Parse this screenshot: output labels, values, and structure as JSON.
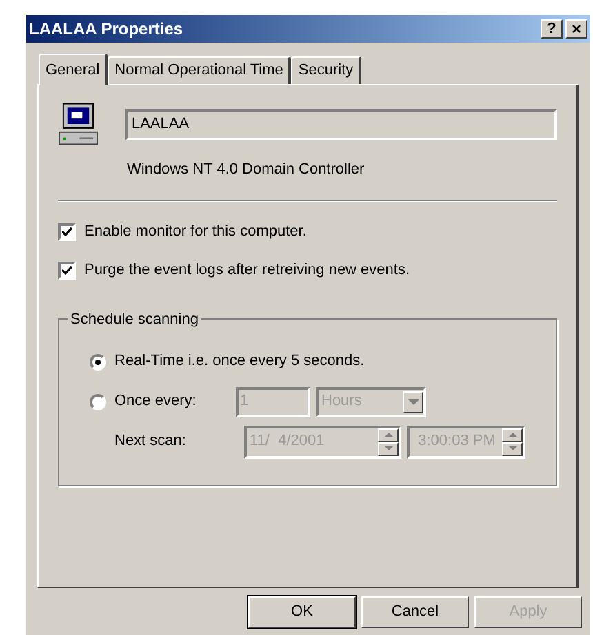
{
  "window": {
    "title": "LAALAA Properties",
    "help_button": "?",
    "close_button": "×"
  },
  "tabs": [
    {
      "label": "General",
      "selected": true
    },
    {
      "label": "Normal Operational Time",
      "selected": false
    },
    {
      "label": "Security",
      "selected": false
    }
  ],
  "computer": {
    "name": "LAALAA",
    "type": "Windows NT 4.0 Domain Controller"
  },
  "checkboxes": [
    {
      "label": "Enable monitor for this computer.",
      "checked": true
    },
    {
      "label": "Purge the event logs after retreiving new events.",
      "checked": true
    }
  ],
  "schedule": {
    "title": "Schedule scanning",
    "options": [
      {
        "label": "Real-Time i.e. once every 5 seconds.",
        "selected": true
      },
      {
        "label": "Once every:",
        "selected": false
      }
    ],
    "interval": {
      "value": "1",
      "disabled": true
    },
    "unit": {
      "value": "Hours",
      "disabled": true
    },
    "next_scan_label": "Next scan:",
    "date": {
      "value": "11/  4/2001",
      "disabled": true
    },
    "time": {
      "value": "3:00:03 PM",
      "disabled": true
    }
  },
  "buttons": [
    {
      "label": "OK",
      "disabled": false,
      "default": true
    },
    {
      "label": "Cancel",
      "disabled": false,
      "default": false
    },
    {
      "label": "Apply",
      "disabled": true,
      "default": false
    }
  ]
}
